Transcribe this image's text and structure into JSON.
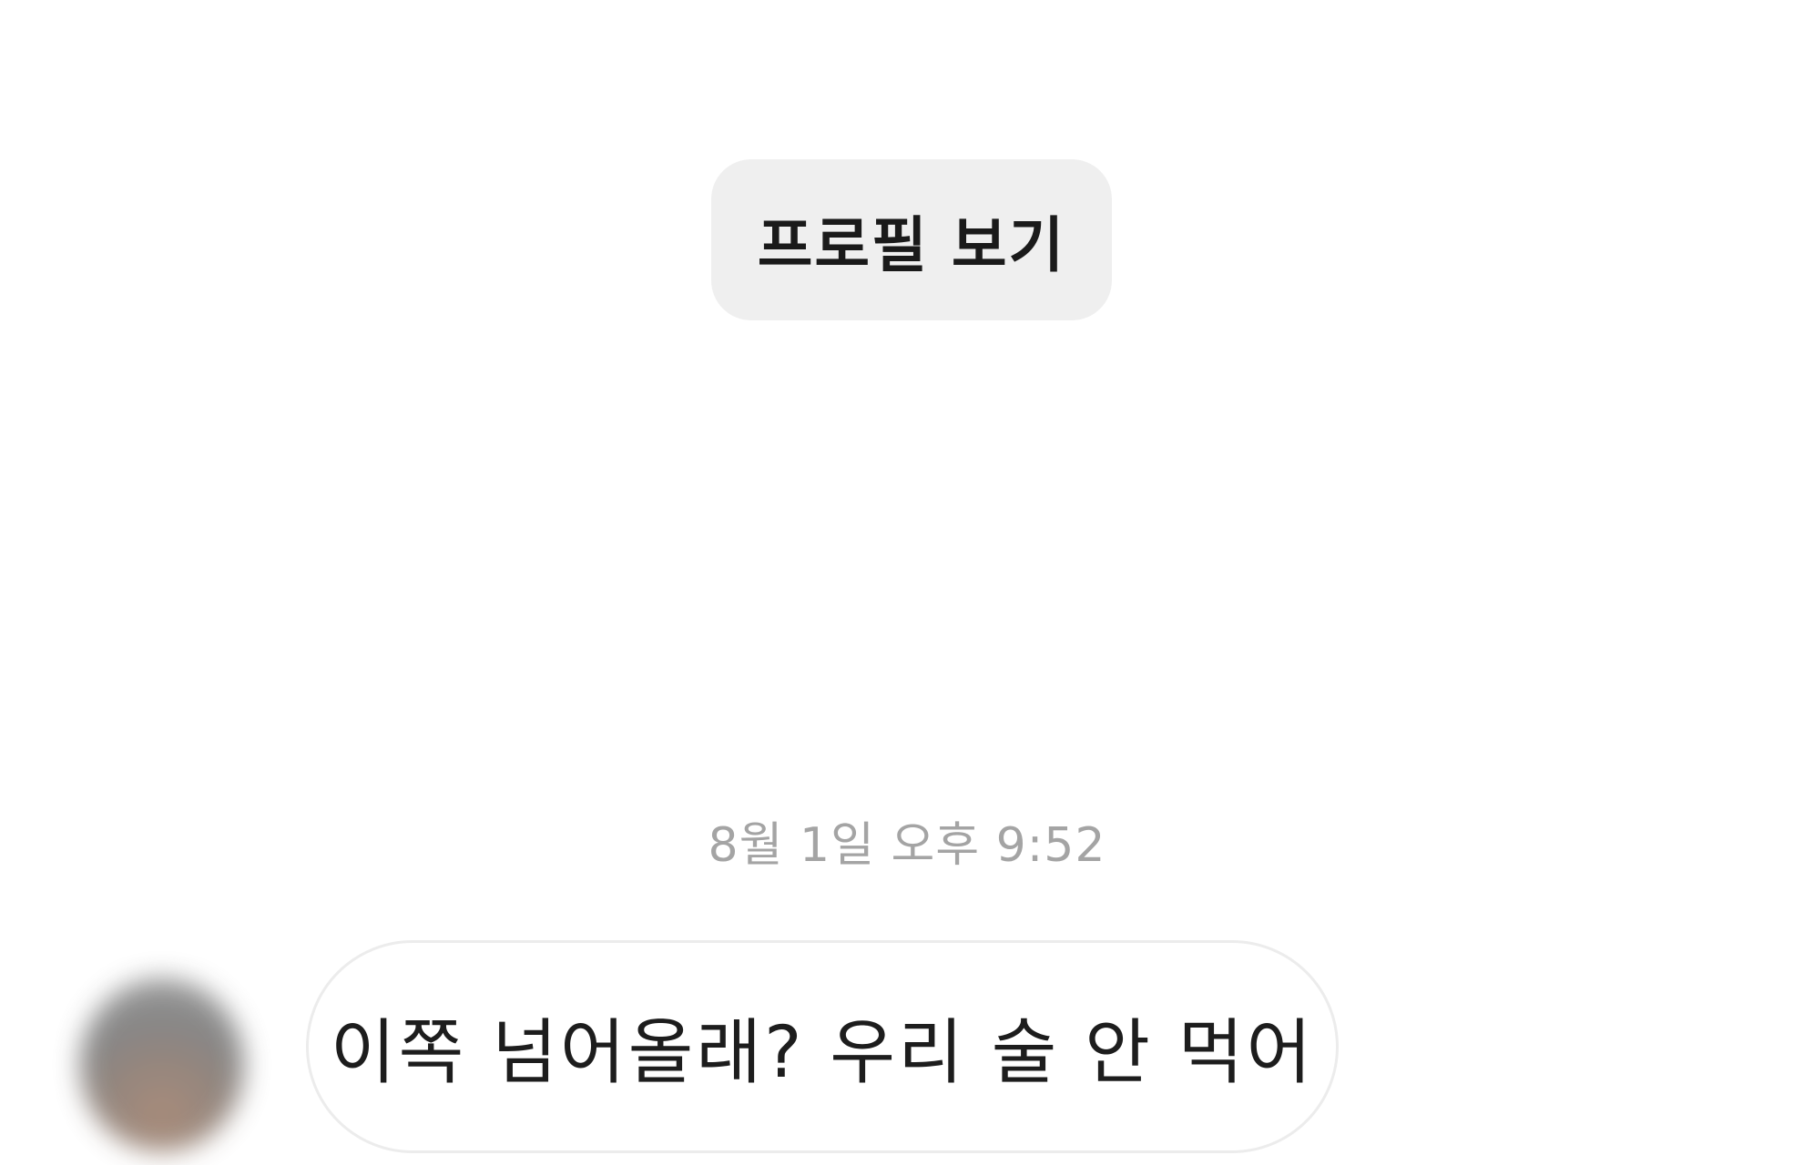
{
  "profile_button": {
    "label": "프로필 보기"
  },
  "thread": {
    "timestamp": "8월 1일 오후 9:52",
    "messages": [
      {
        "sender": "other",
        "text": "이쪽 넘어올래? 우리 술 안 먹어"
      }
    ]
  },
  "colors": {
    "background": "#ffffff",
    "button_bg": "#efefef",
    "timestamp_text": "#a4a4a4",
    "bubble_border": "#ececec",
    "message_text": "#1d1d1d"
  }
}
